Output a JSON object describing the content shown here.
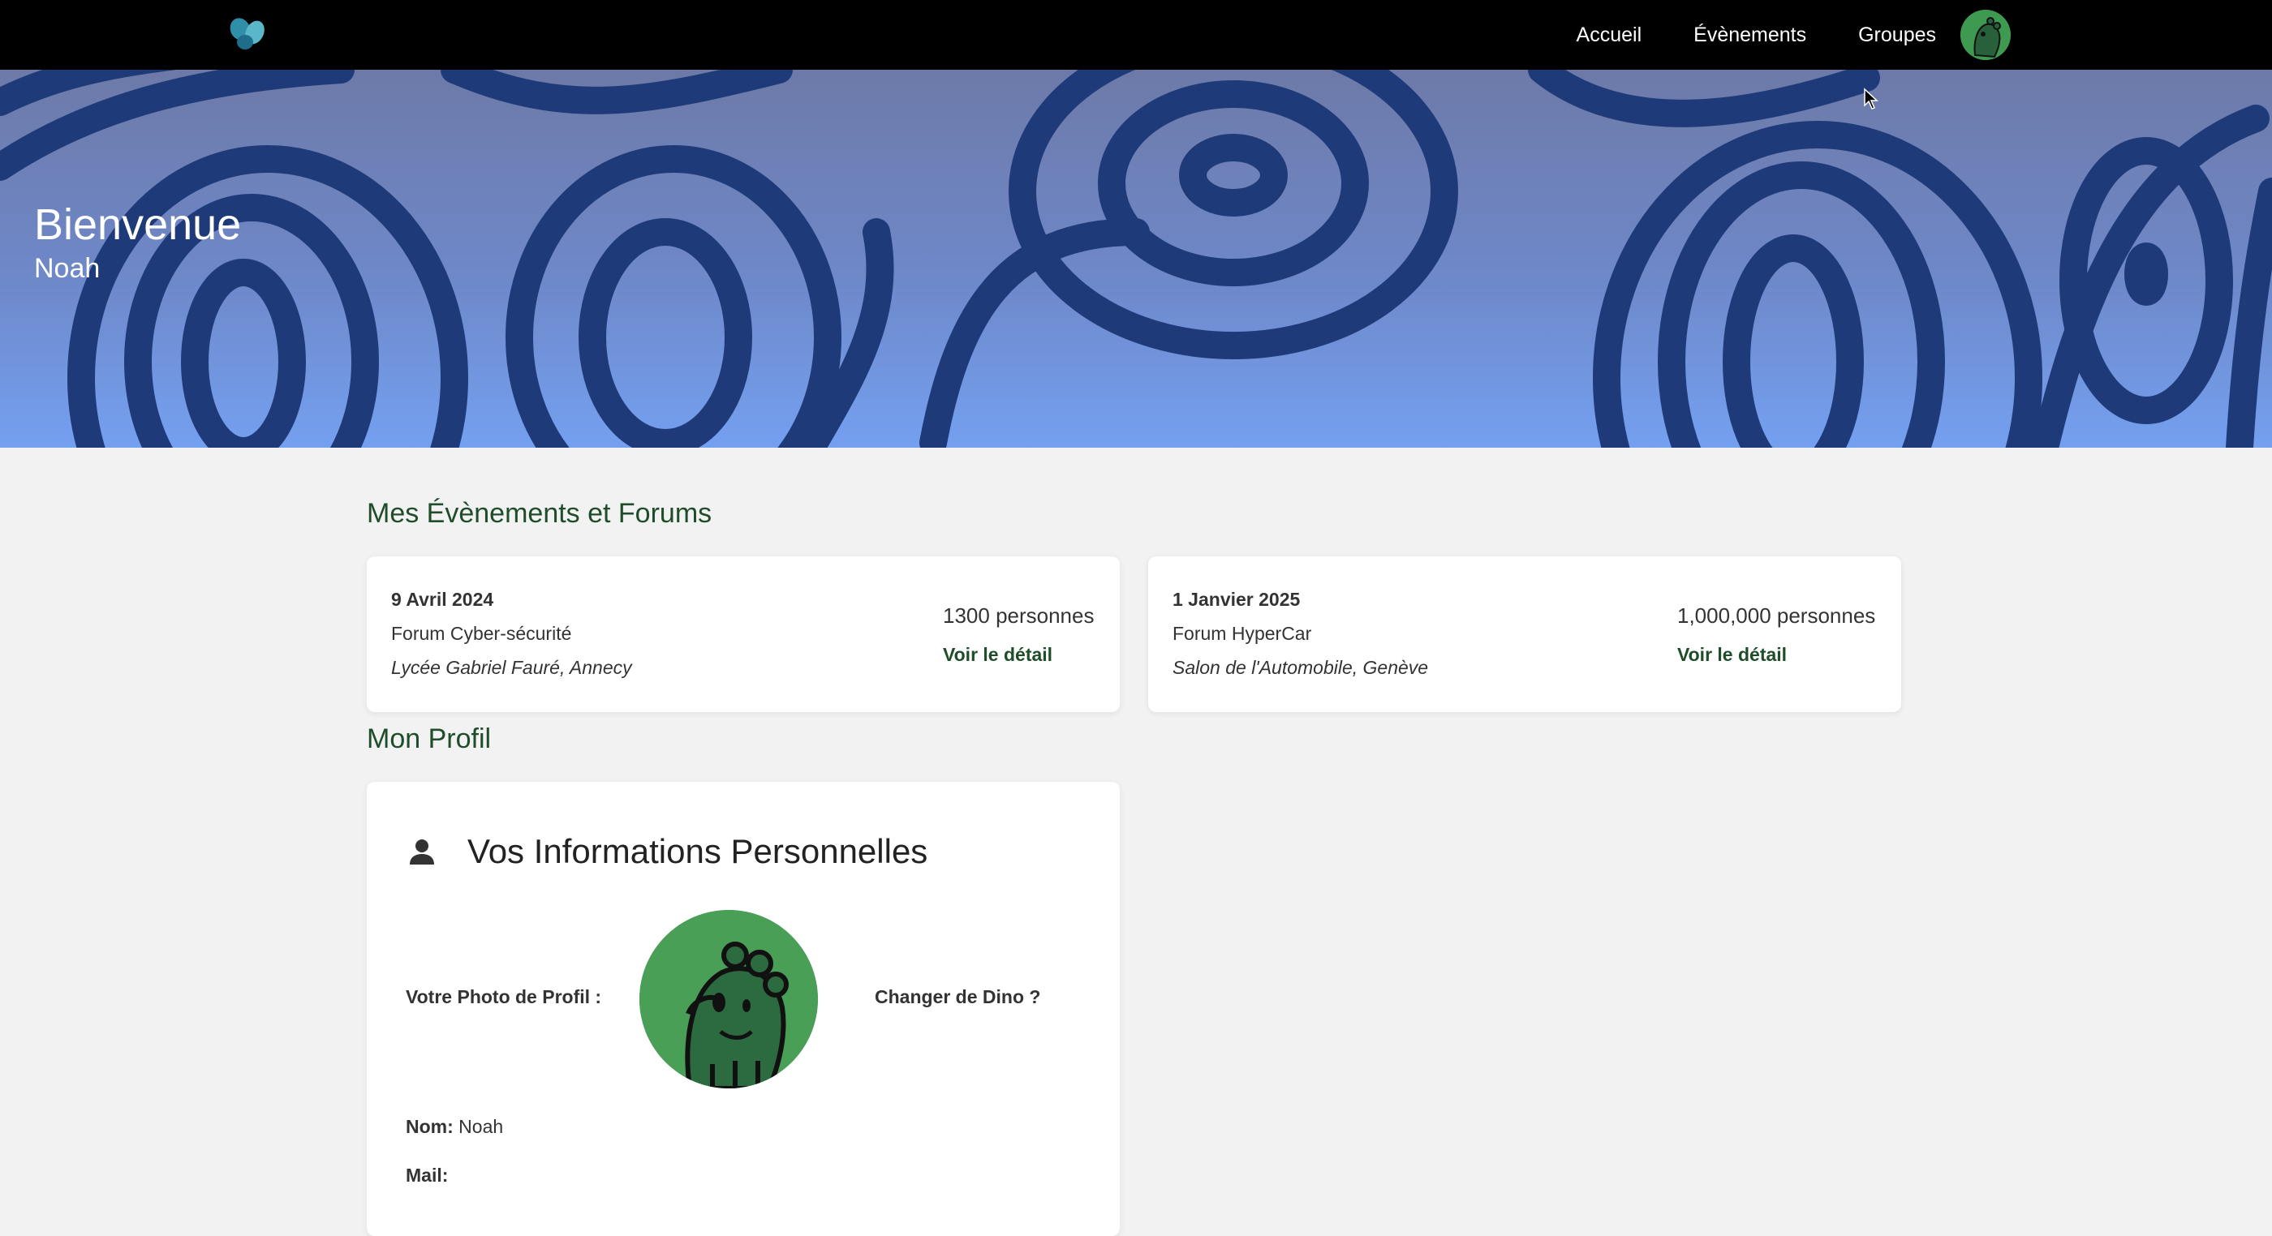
{
  "navbar": {
    "links": [
      "Accueil",
      "Évènements",
      "Groupes"
    ]
  },
  "hero": {
    "title": "Bienvenue",
    "name": "Noah"
  },
  "events_section": {
    "title": "Mes Évènements et Forums",
    "events": [
      {
        "date": "9 Avril 2024",
        "name": "Forum Cyber-sécurité",
        "place": "Lycée Gabriel Fauré, Annecy",
        "count": "1300 personnes",
        "link": "Voir le détail"
      },
      {
        "date": "1 Janvier 2025",
        "name": "Forum HyperCar",
        "place": "Salon de l'Automobile, Genève",
        "count": "1,000,000 personnes",
        "link": "Voir le détail"
      }
    ]
  },
  "profile_section": {
    "title": "Mon Profil",
    "card_title": "Vos Informations Personnelles",
    "photo_label": "Votre Photo de Profil :",
    "change_label": "Changer de Dino ?",
    "name_label": "Nom:",
    "name_value": "Noah",
    "mail_label": "Mail:",
    "mail_value": ""
  },
  "colors": {
    "navbar": "#000000",
    "accent_green": "#1f4d2a",
    "hero_top": "#6d7aa8",
    "hero_bottom": "#74a0f0",
    "wave": "#1f3a78",
    "avatar_bg": "#4a9f57"
  }
}
